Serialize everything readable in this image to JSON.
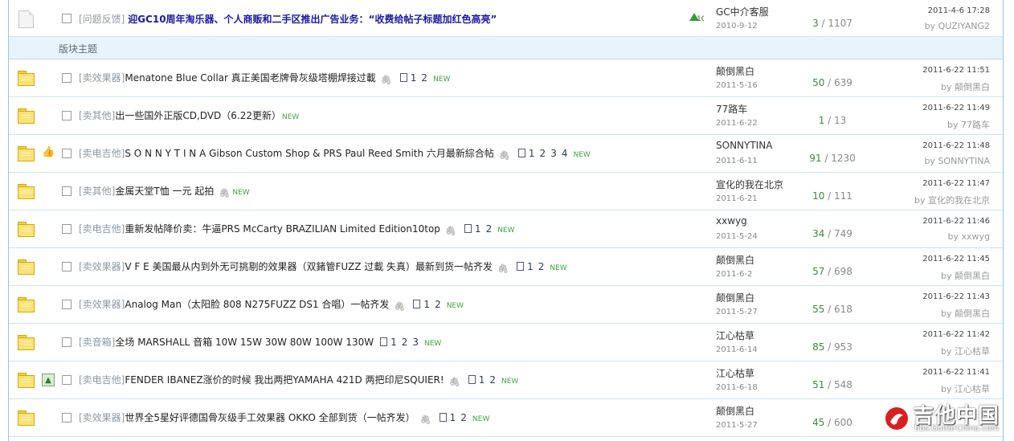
{
  "top_thread": {
    "type": "[问题反馈]",
    "subject": "迎GC10周年淘乐器、个人商贩和二手区推出广告业务：“收费给帖子标题加红色高亮”",
    "author": "GC中介客服",
    "author_date": "2010-9-12",
    "replies": "3",
    "views": "1107",
    "last_time": "2011-4-6 17:28",
    "last_by": "QUZIYANG2"
  },
  "section_title": "版块主题",
  "new_label": "NEW",
  "by_label": "by",
  "threads": [
    {
      "type": "[卖效果器]",
      "subject": "Menatone Blue Collar 真正美国老牌骨灰级塔棚焊接过載",
      "attach": true,
      "pages": [
        "1",
        "2"
      ],
      "author": "颠倒黑白",
      "author_date": "2011-5-16",
      "replies": "50",
      "views": "639",
      "last_time": "2011-6-22 11:51",
      "last_by": "颠倒黑白",
      "icon": ""
    },
    {
      "type": "[卖其他]",
      "subject": "出一些国外正版CD,DVD（6.22更新）",
      "attach": false,
      "pages": [],
      "author": "77路车",
      "author_date": "2011-6-22",
      "replies": "1",
      "views": "13",
      "last_time": "2011-6-22 11:49",
      "last_by": "77路车",
      "icon": ""
    },
    {
      "type": "[卖电吉他]",
      "subject": "S O N N Y T I N A   Gibson Custom Shop & PRS Paul Reed Smith 六月最新綜合帖",
      "attach": true,
      "pages": [
        "1",
        "2",
        "3",
        "4"
      ],
      "author": "SONNYTINA",
      "author_date": "2011-6-11",
      "replies": "91",
      "views": "1230",
      "last_time": "2011-6-22 11:48",
      "last_by": "SONNYTINA",
      "icon": "thumb"
    },
    {
      "type": "[卖其他]",
      "subject": "金属天堂T恤  一元  起拍",
      "attach": true,
      "pages": [],
      "author": "宣化的我在北京",
      "author_date": "2011-6-21",
      "replies": "10",
      "views": "111",
      "last_time": "2011-6-22 11:47",
      "last_by": "宣化的我在北京",
      "icon": ""
    },
    {
      "type": "[卖电吉他]",
      "subject": "重新发帖降价卖：牛逼PRS McCarty BRAZILIAN Limited Edition10top",
      "attach": true,
      "pages": [
        "1",
        "2"
      ],
      "author": "xxwyg",
      "author_date": "2011-5-24",
      "replies": "34",
      "views": "749",
      "last_time": "2011-6-22 11:46",
      "last_by": "xxwyg",
      "icon": ""
    },
    {
      "type": "[卖效果器]",
      "subject": "V F E 美国最从内到外无可挑剔的效果器（双鍺管FUZZ 过載  失真）最新到货一帖齐发",
      "attach": true,
      "pages": [
        "1",
        "2"
      ],
      "author": "颠倒黑白",
      "author_date": "2011-6-2",
      "replies": "57",
      "views": "698",
      "last_time": "2011-6-22 11:45",
      "last_by": "颠倒黑白",
      "icon": ""
    },
    {
      "type": "[卖效果器]",
      "subject": "Analog Man（太阳脸  808 N275FUZZ DS1 合唱）一帖齐发",
      "attach": true,
      "pages": [
        "1",
        "2"
      ],
      "author": "颠倒黑白",
      "author_date": "2011-5-27",
      "replies": "55",
      "views": "618",
      "last_time": "2011-6-22 11:43",
      "last_by": "颠倒黑白",
      "icon": ""
    },
    {
      "type": "[卖音箱]",
      "subject": "全场  MARSHALL 音箱  10W 15W 30W 80W 100W 130W",
      "attach": false,
      "pages": [
        "1",
        "2",
        "3"
      ],
      "author": "江心枯草",
      "author_date": "2011-6-14",
      "replies": "85",
      "views": "953",
      "last_time": "2011-6-22 11:42",
      "last_by": "江心枯草",
      "icon": ""
    },
    {
      "type": "[卖电吉他]",
      "subject": "FENDER IBANEZ涨价的时候  我出两把YAMAHA 421D 两把印尼SQUIER!",
      "attach": true,
      "pages": [
        "1",
        "2"
      ],
      "author": "江心枯草",
      "author_date": "2011-6-18",
      "replies": "51",
      "views": "548",
      "last_time": "2011-6-22 11:41",
      "last_by": "江心枯草",
      "icon": "image"
    },
    {
      "type": "[卖效果器]",
      "subject": "世界全5星好评德国骨灰级手工效果器  OKKO 全部到货（一帖齐发）",
      "attach": true,
      "pages": [
        "1",
        "2"
      ],
      "author": "颠倒黑白",
      "author_date": "2011-5-27",
      "replies": "45",
      "views": "600",
      "last_time": "",
      "last_by": "",
      "icon": ""
    }
  ],
  "watermark": {
    "brand": "吉他中国",
    "url": "bbs.GuitarChina.com"
  },
  "colors": {
    "accent_green": "#3fa33f",
    "highlight_blue": "#1a1aa6",
    "border": "#9fc4d8"
  }
}
